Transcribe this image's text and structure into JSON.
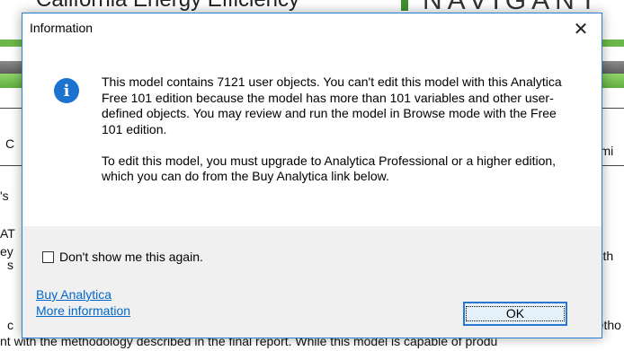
{
  "background": {
    "title_fragment": "California Energy Efficiency",
    "logo_fragment": "NAVIGANT",
    "side_texts": {
      "row1_left": "C",
      "row1_right": "ommi",
      "row2_left": "'s",
      "row3_left": "AT",
      "row4_left": "ey",
      "row4_right": "on th",
      "row5_left": "s",
      "row6_left": "c",
      "row6_right": "metho"
    },
    "bottom_line": "nt with the methodology described in the final report. While this model is capable of produ",
    "colors": {
      "green": "#6bb84a",
      "gray": "#6e6e6e"
    }
  },
  "dialog": {
    "title": "Information",
    "close_icon": "close-icon",
    "icon": "info-icon",
    "icon_glyph": "i",
    "message_paragraph_1": "This model contains 7121 user objects.  You can't edit this model with this Analytica Free 101 edition because the model has more than 101 variables and other user-defined objects.  You may review and run the model in Browse mode with the Free 101 edition.",
    "message_paragraph_2": "To edit this model, you must upgrade to Analytica Professional or a higher edition, which you can do from the Buy Analytica link below.",
    "checkbox_label": "Don't show me this again.",
    "checkbox_checked": false,
    "link_buy": "Buy Analytica",
    "link_more": "More information",
    "ok_label": "OK",
    "colors": {
      "accent": "#1c73cf",
      "link": "#0066cc",
      "footer_bg": "#f0f0f0"
    }
  }
}
